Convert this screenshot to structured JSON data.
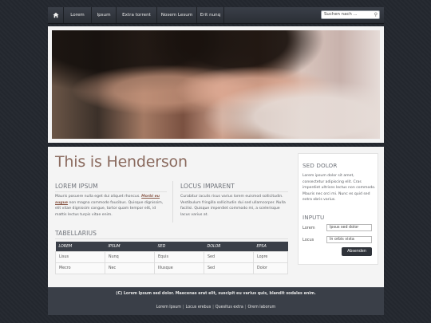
{
  "nav": {
    "home_icon": "home-icon",
    "items": [
      "Lorem",
      "Ipsum",
      "Extra torrent",
      "Nosem Lesum",
      "Erit nunq"
    ],
    "search_placeholder": "Suchen nach ..."
  },
  "main": {
    "title": "This is Henderson",
    "col1": {
      "heading": "LOREM IPSUM",
      "text_before": "Mauris posuere nulla eget dui aliquet rhoncus. ",
      "link": "Morbi eu augue",
      "text_after": " non magna commodo faucibus. Quisque dignissim, elit vitae dignissim congue, tortor quam tempor elit, id mattis lectus turpis vitae enim."
    },
    "col2": {
      "heading": "LOCUS IMPARENT",
      "text": "Curabitur iaculis risus varius lorem euismod sollicitudin. Vestibulum fringilla sollicitudin dui sed ullamcorper. Nulla facilisi. Quisque imperdiet commodo mi, a scelerisque lacus varius at."
    },
    "table": {
      "heading": "TABELLARIUS",
      "columns": [
        "LOREM",
        "IPSUM",
        "SED",
        "DOLOR",
        "EPSA"
      ],
      "rows": [
        [
          "Lisus",
          "Nunq",
          "Equis",
          "Sed",
          "Lopre"
        ],
        [
          "Mecro",
          "Nec",
          "Illusque",
          "Sed",
          "Dolor"
        ]
      ]
    }
  },
  "sidebar": {
    "heading1": "SED DOLOR",
    "text": "Lorem ipsum dolor sit amet, consectetur adipiscing elit. Cras imperdiet ultrices lectus non commodo. Mauris nec orci mi. Nunc es quid sed extra obris varius.",
    "heading2": "INPUTU",
    "name_label": "Lorem",
    "name_value": "Ipsus sed dolor",
    "location_label": "Locus",
    "location_value": "In orbis vista",
    "submit": "Absenden"
  },
  "footer": {
    "copyright": "(C) Lorem Ipsum sed dolor. Maecenas erat elit, suscipit eu varius quis, blandit sodales enim.",
    "links": [
      "Lorem Ipsum",
      "Locus erebus",
      "Quesitus extra",
      "Orem laborum"
    ],
    "separator": "|"
  }
}
